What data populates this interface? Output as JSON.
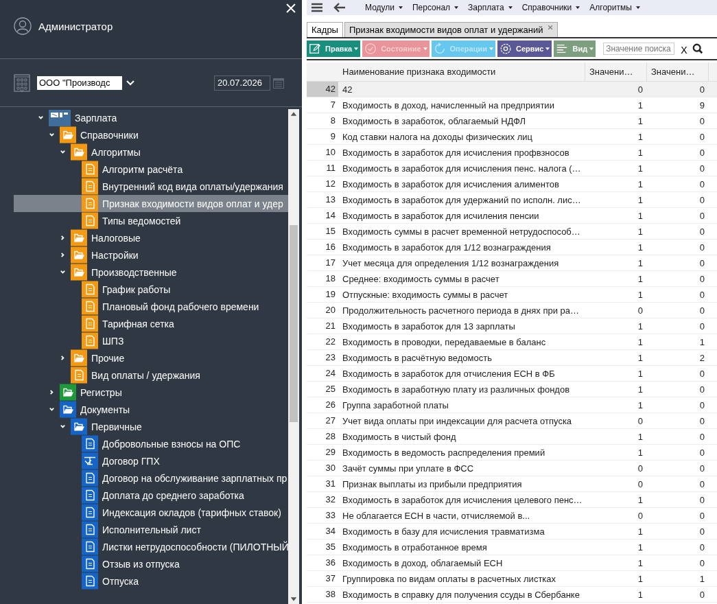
{
  "sidebar": {
    "user": "Администратор",
    "organization": {
      "value": "ООО \"Производс"
    },
    "date": {
      "value": "20.07.2026"
    },
    "tree": [
      {
        "label": "Зарплата",
        "kind": "module",
        "color": "#3f6e9c",
        "expanded": true,
        "selected": false,
        "children": [
          {
            "label": "Справочники",
            "kind": "folder",
            "color": "#f39a12",
            "expanded": true,
            "selected": false,
            "children": [
              {
                "label": "Алгоритмы",
                "kind": "folder",
                "color": "#f39a12",
                "expanded": true,
                "selected": false,
                "children": [
                  {
                    "label": "Алгоритм расчёта",
                    "kind": "document",
                    "color": "#f39a12",
                    "selected": false
                  },
                  {
                    "label": "Внутренний код вида оплаты/удержания",
                    "kind": "document",
                    "color": "#f39a12",
                    "selected": false
                  },
                  {
                    "label": "Признак входимости видов оплат и удер",
                    "kind": "document",
                    "color": "#f39a12",
                    "selected": true
                  },
                  {
                    "label": "Типы ведомостей",
                    "kind": "document",
                    "color": "#f39a12",
                    "selected": false
                  }
                ]
              },
              {
                "label": "Налоговые",
                "kind": "folder",
                "color": "#f39a12",
                "expanded": false,
                "selected": false
              },
              {
                "label": "Настройки",
                "kind": "folder",
                "color": "#f39a12",
                "expanded": false,
                "selected": false
              },
              {
                "label": "Производственные",
                "kind": "folder",
                "color": "#f39a12",
                "expanded": true,
                "selected": false,
                "children": [
                  {
                    "label": "График работы",
                    "kind": "document",
                    "color": "#f39a12",
                    "selected": false
                  },
                  {
                    "label": "Плановый фонд рабочего времени",
                    "kind": "document",
                    "color": "#f39a12",
                    "selected": false
                  },
                  {
                    "label": "Тарифная сетка",
                    "kind": "document",
                    "color": "#f39a12",
                    "selected": false
                  },
                  {
                    "label": "ШПЗ",
                    "kind": "document",
                    "color": "#f39a12",
                    "selected": false
                  }
                ]
              },
              {
                "label": "Прочие",
                "kind": "folder",
                "color": "#f39a12",
                "expanded": false,
                "selected": false
              },
              {
                "label": "Вид оплаты / удержания",
                "kind": "document",
                "color": "#f39a12",
                "selected": false
              }
            ]
          },
          {
            "label": "Регистры",
            "kind": "folder",
            "color": "#1f9a3a",
            "expanded": false,
            "selected": false
          },
          {
            "label": "Документы",
            "kind": "folder",
            "color": "#1565c8",
            "expanded": true,
            "selected": false,
            "children": [
              {
                "label": "Первичные",
                "kind": "folder",
                "color": "#1565c8",
                "expanded": true,
                "selected": false,
                "children": [
                  {
                    "label": "Добровольные взносы на ОПС",
                    "kind": "document",
                    "color": "#1565c8",
                    "selected": false
                  },
                  {
                    "label": "Договор ГПХ",
                    "kind": "contract",
                    "color": "#1565c8",
                    "selected": false
                  },
                  {
                    "label": "Договор на обслуживание зарплатных пр",
                    "kind": "document",
                    "color": "#1565c8",
                    "selected": false
                  },
                  {
                    "label": "Доплата до среднего заработка",
                    "kind": "document",
                    "color": "#1565c8",
                    "selected": false
                  },
                  {
                    "label": "Индексация окладов (тарифных ставок)",
                    "kind": "document",
                    "color": "#1565c8",
                    "selected": false
                  },
                  {
                    "label": "Исполнительный лист",
                    "kind": "document",
                    "color": "#1565c8",
                    "selected": false
                  },
                  {
                    "label": "Листки нетрудоспособности (ПИЛОТНЫЙ",
                    "kind": "document",
                    "color": "#1565c8",
                    "selected": false
                  },
                  {
                    "label": "Отзыв из отпуска",
                    "kind": "document",
                    "color": "#1565c8",
                    "selected": false
                  },
                  {
                    "label": "Отпуска",
                    "kind": "document",
                    "color": "#1565c8",
                    "selected": false
                  }
                ]
              }
            ]
          }
        ]
      }
    ]
  },
  "menu": [
    "Модули",
    "Персонал",
    "Зарплата",
    "Справочники",
    "Алгоритмы"
  ],
  "tabs": [
    {
      "label": "Кадры",
      "selected": false,
      "closable": false
    },
    {
      "label": "Признак входимости видов оплат и удержаний",
      "selected": true,
      "closable": true
    }
  ],
  "toolbar": [
    {
      "label": "Правка",
      "kind": "edit",
      "color": "#178f7c",
      "disabled": false
    },
    {
      "label": "Состояние",
      "kind": "status",
      "color": "#e9939a",
      "disabled": true
    },
    {
      "label": "Операции",
      "kind": "operations",
      "color": "#67c8ef",
      "disabled": true
    },
    {
      "label": "Сервис",
      "kind": "service",
      "color": "#5b5897",
      "disabled": false
    },
    {
      "label": "Вид",
      "kind": "view",
      "color": "#7d9f80",
      "disabled": false
    }
  ],
  "search": {
    "placeholder": "Значение поиска",
    "clear": "X"
  },
  "table": {
    "columns": [
      "Наименование признака входимости",
      "Значени…",
      "Значени…"
    ],
    "rows": [
      {
        "number": "42",
        "name": "42",
        "value_1": "0",
        "value_2": "0",
        "selected": true
      },
      {
        "number": "7",
        "name": "Входимость в доход, начисленный на предприятии",
        "value_1": "1",
        "value_2": "9",
        "selected": false
      },
      {
        "number": "8",
        "name": "Входимость в заработок, облагаемый НДФЛ",
        "value_1": "1",
        "value_2": "0",
        "selected": false
      },
      {
        "number": "9",
        "name": "Код ставки налога на доходы физических лиц",
        "value_1": "1",
        "value_2": "0",
        "selected": false
      },
      {
        "number": "10",
        "name": "Входимость в заработок для исчисления профвзносов",
        "value_1": "1",
        "value_2": "0",
        "selected": false
      },
      {
        "number": "11",
        "name": "Входимость в заработок для исчисления пенс. налога (…",
        "value_1": "1",
        "value_2": "0",
        "selected": false
      },
      {
        "number": "12",
        "name": "Входимость в заработок для исчисления алиментов",
        "value_1": "1",
        "value_2": "0",
        "selected": false
      },
      {
        "number": "13",
        "name": "Входимость в заработок для удержаний по исполн. лис…",
        "value_1": "1",
        "value_2": "0",
        "selected": false
      },
      {
        "number": "14",
        "name": "Входимость в заработок для исчиления пенсии",
        "value_1": "1",
        "value_2": "0",
        "selected": false
      },
      {
        "number": "15",
        "name": "Входимость суммы в расчет временной нетрудоспособ…",
        "value_1": "1",
        "value_2": "0",
        "selected": false
      },
      {
        "number": "16",
        "name": "Входимость в заработок для 1/12 вознаграждения",
        "value_1": "1",
        "value_2": "0",
        "selected": false
      },
      {
        "number": "17",
        "name": "Учет месяца для определения 1/12 вознаграждения",
        "value_1": "1",
        "value_2": "0",
        "selected": false
      },
      {
        "number": "18",
        "name": "Среднее: входимость суммы в расчет",
        "value_1": "1",
        "value_2": "0",
        "selected": false
      },
      {
        "number": "19",
        "name": "Отпускные: входимость суммы в расчет",
        "value_1": "1",
        "value_2": "0",
        "selected": false
      },
      {
        "number": "20",
        "name": "Продолжительность расчетного периода в днях при ра…",
        "value_1": "0",
        "value_2": "0",
        "selected": false
      },
      {
        "number": "21",
        "name": "Входимость в заработок для 13 зарплаты",
        "value_1": "1",
        "value_2": "0",
        "selected": false
      },
      {
        "number": "22",
        "name": "Входимость в проводки, передаваемые в баланс",
        "value_1": "1",
        "value_2": "1",
        "selected": false
      },
      {
        "number": "23",
        "name": "Входимость в расчётную ведомость",
        "value_1": "1",
        "value_2": "2",
        "selected": false
      },
      {
        "number": "24",
        "name": "Входимость в заработок для отчисления ЕСН в ФБ",
        "value_1": "1",
        "value_2": "0",
        "selected": false
      },
      {
        "number": "25",
        "name": "Входимость в заработную плату из различных фондов",
        "value_1": "1",
        "value_2": "0",
        "selected": false
      },
      {
        "number": "26",
        "name": "Группа заработной платы",
        "value_1": "1",
        "value_2": "0",
        "selected": false
      },
      {
        "number": "27",
        "name": "Учет вида оплаты при индексации для расчета отпуска",
        "value_1": "0",
        "value_2": "0",
        "selected": false
      },
      {
        "number": "28",
        "name": "Входимость в чистый фонд",
        "value_1": "1",
        "value_2": "0",
        "selected": false
      },
      {
        "number": "29",
        "name": "Входимость в ведомость распределения премий",
        "value_1": "1",
        "value_2": "0",
        "selected": false
      },
      {
        "number": "30",
        "name": "Зачёт суммы при уплате в ФСС",
        "value_1": "0",
        "value_2": "0",
        "selected": false
      },
      {
        "number": "31",
        "name": "Признак выплаты из прибыли предприятия",
        "value_1": "0",
        "value_2": "0",
        "selected": false
      },
      {
        "number": "32",
        "name": "Входимость в заработок для исчисления целевого пенс…",
        "value_1": "1",
        "value_2": "0",
        "selected": false
      },
      {
        "number": "33",
        "name": "Не облагается ЕСН в части, отчисляемой в...",
        "value_1": "0",
        "value_2": "0",
        "selected": false
      },
      {
        "number": "34",
        "name": "Входимость в базу для исчисления травматизма",
        "value_1": "1",
        "value_2": "0",
        "selected": false
      },
      {
        "number": "35",
        "name": "Входимость в отработанное время",
        "value_1": "1",
        "value_2": "0",
        "selected": false
      },
      {
        "number": "36",
        "name": "Входимость в доход, облагаемый ЕСН",
        "value_1": "1",
        "value_2": "0",
        "selected": false
      },
      {
        "number": "37",
        "name": "Группировка по видам оплаты в расчетных листках",
        "value_1": "1",
        "value_2": "1",
        "selected": false
      },
      {
        "number": "38",
        "name": "Входимость в справку для получения ссуды в Сбербанке",
        "value_1": "1",
        "value_2": "0",
        "selected": false
      }
    ]
  }
}
